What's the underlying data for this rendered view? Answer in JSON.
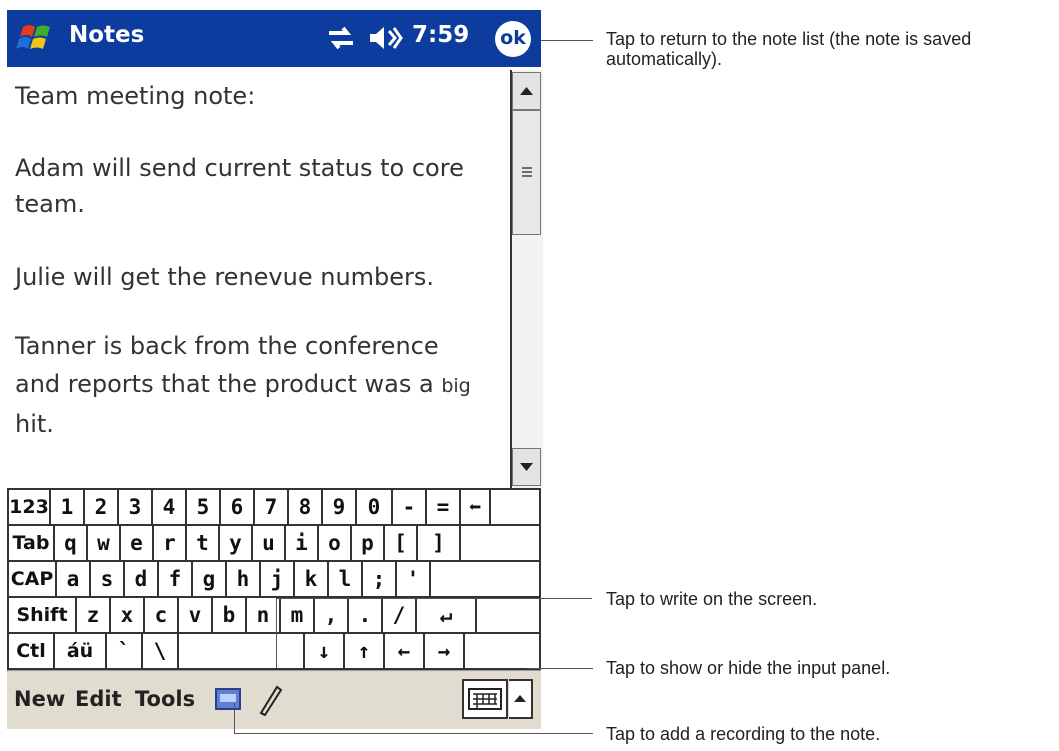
{
  "titlebar": {
    "app_title": "Notes",
    "time": "7:59",
    "ok_label": "ok",
    "icons": [
      "windows-start-icon",
      "connectivity-icon",
      "speaker-icon"
    ]
  },
  "note": {
    "lines": [
      "Team meeting note:",
      "Adam will send current status to core",
      "team.",
      "Julie will get the renevue numbers.",
      "Tanner is back from the conference",
      "and reports that the product was a ",
      "hit."
    ],
    "small_word": "big"
  },
  "keyboard": {
    "rows": [
      [
        "123",
        "1",
        "2",
        "3",
        "4",
        "5",
        "6",
        "7",
        "8",
        "9",
        "0",
        "-",
        "=",
        "⬅"
      ],
      [
        "Tab",
        "q",
        "w",
        "e",
        "r",
        "t",
        "y",
        "u",
        "i",
        "o",
        "p",
        "[",
        "]"
      ],
      [
        "CAP",
        "a",
        "s",
        "d",
        "f",
        "g",
        "h",
        "j",
        "k",
        "l",
        ";",
        "'"
      ],
      [
        "Shift",
        "z",
        "x",
        "c",
        "v",
        "b",
        "n",
        "m",
        ",",
        ".",
        "/",
        "↵"
      ],
      [
        "Ctl",
        "áü",
        "`",
        "\\",
        " ",
        "↓",
        "↑",
        "←",
        "→"
      ]
    ]
  },
  "menubar": {
    "new": "New",
    "edit": "Edit",
    "tools": "Tools"
  },
  "callouts": {
    "ok": [
      "Tap to return to the note list (the note is saved",
      "automatically)."
    ],
    "write": "Tap to write on the screen.",
    "input_panel": "Tap to show or hide the input panel.",
    "recording": "Tap to add a recording to the note."
  },
  "colors": {
    "titlebar": "#0b3c9e",
    "menubar": "#e0dcd0"
  }
}
